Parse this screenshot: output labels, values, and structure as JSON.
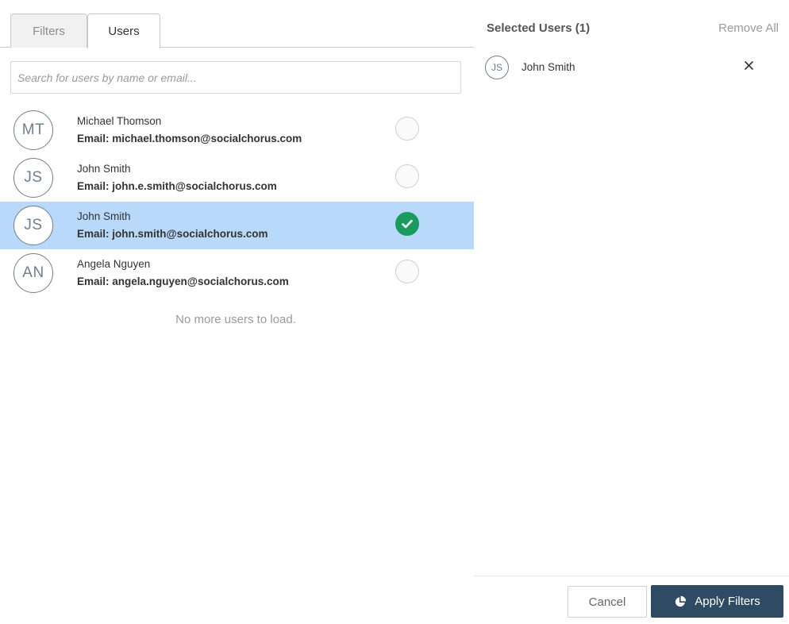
{
  "tabs": [
    {
      "label": "Filters",
      "active": false
    },
    {
      "label": "Users",
      "active": true
    }
  ],
  "search": {
    "placeholder": "Search for users by name or email...",
    "value": ""
  },
  "users": [
    {
      "initials": "MT",
      "name": "Michael Thomson",
      "email": "Email: michael.thomson@socialchorus.com",
      "selected": false
    },
    {
      "initials": "JS",
      "name": "John Smith",
      "email": "Email: john.e.smith@socialchorus.com",
      "selected": false
    },
    {
      "initials": "JS",
      "name": "John Smith",
      "email": "Email: john.smith@socialchorus.com",
      "selected": true
    },
    {
      "initials": "AN",
      "name": "Angela Nguyen",
      "email": "Email: angela.nguyen@socialchorus.com",
      "selected": false
    }
  ],
  "list_end_message": "No more users to load.",
  "selected_panel": {
    "title": "Selected Users (1)",
    "remove_all_label": "Remove All",
    "items": [
      {
        "initials": "JS",
        "name": "John Smith"
      }
    ]
  },
  "footer": {
    "cancel_label": "Cancel",
    "apply_label": "Apply Filters"
  },
  "colors": {
    "selected_row": "#b8d9fa",
    "check_on": "#1a9b5e",
    "apply_button": "#2f4b63"
  },
  "icons": {
    "check": "checkmark-icon",
    "remove": "close-icon",
    "apply": "pie-chart-icon"
  }
}
